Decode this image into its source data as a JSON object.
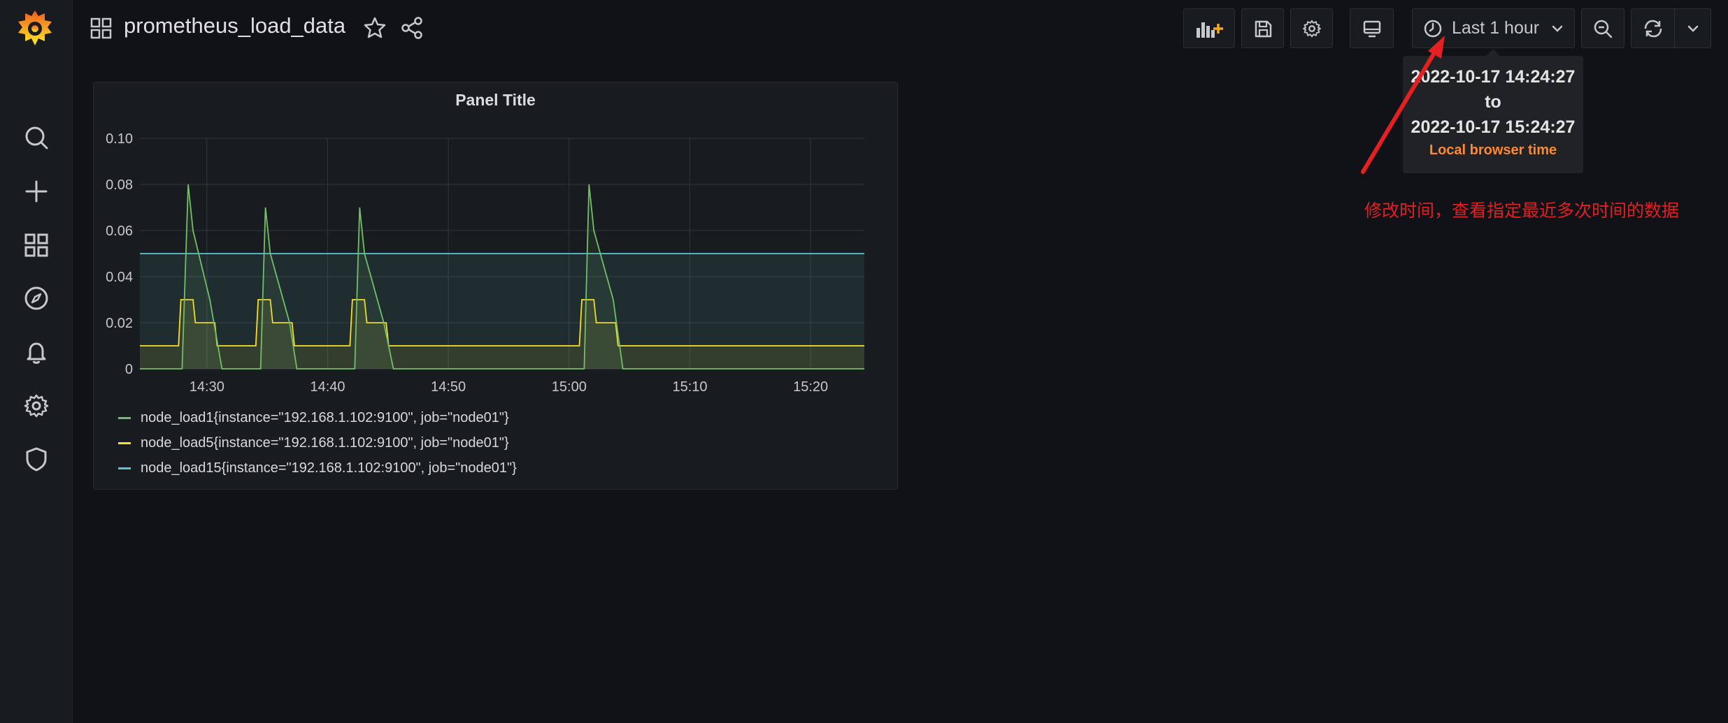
{
  "dashboard": {
    "title": "prometheus_load_data"
  },
  "sidebar": {
    "items": [
      {
        "name": "search-icon"
      },
      {
        "name": "plus-icon"
      },
      {
        "name": "dashboards-icon"
      },
      {
        "name": "explore-icon"
      },
      {
        "name": "alerting-icon"
      },
      {
        "name": "gear-icon"
      },
      {
        "name": "shield-icon"
      }
    ]
  },
  "toolbar": {
    "time_range_label": "Last 1 hour"
  },
  "tooltip": {
    "from": "2022-10-17 14:24:27",
    "to_word": "to",
    "to": "2022-10-17 15:24:27",
    "timezone": "Local browser time"
  },
  "annotation": {
    "text": "修改时间，查看指定最近多次时间的数据"
  },
  "panel": {
    "title": "Panel Title"
  },
  "chart_data": {
    "type": "line",
    "title": "Panel Title",
    "x": [
      "14:24:27",
      "15:24:27"
    ],
    "x_ticks": [
      "14:30",
      "14:40",
      "14:50",
      "15:00",
      "15:10",
      "15:20"
    ],
    "y_ticks": [
      "0",
      "0.02",
      "0.04",
      "0.06",
      "0.08",
      "0.10"
    ],
    "ylim": [
      0,
      0.1
    ],
    "grid": true,
    "legend_position": "bottom-left",
    "series": [
      {
        "name": "node_load1{instance=\"192.168.1.102:9100\", job=\"node01\"}",
        "color": "#73bf69",
        "points": [
          [
            0,
            0
          ],
          [
            3.5,
            0
          ],
          [
            4.0,
            0.08
          ],
          [
            4.4,
            0.06
          ],
          [
            5.8,
            0.03
          ],
          [
            6.8,
            0
          ],
          [
            10,
            0
          ],
          [
            10.4,
            0.07
          ],
          [
            10.8,
            0.05
          ],
          [
            12.4,
            0.02
          ],
          [
            13,
            0
          ],
          [
            17.8,
            0
          ],
          [
            18.2,
            0.07
          ],
          [
            18.6,
            0.05
          ],
          [
            20.2,
            0.02
          ],
          [
            21,
            0
          ],
          [
            36.8,
            0
          ],
          [
            37.2,
            0.08
          ],
          [
            37.6,
            0.06
          ],
          [
            39.2,
            0.03
          ],
          [
            40,
            0
          ],
          [
            60,
            0
          ]
        ]
      },
      {
        "name": "node_load5{instance=\"192.168.1.102:9100\", job=\"node01\"}",
        "color": "#fade2a",
        "points": [
          [
            0,
            0.01
          ],
          [
            3.2,
            0.01
          ],
          [
            3.4,
            0.03
          ],
          [
            4.4,
            0.03
          ],
          [
            4.6,
            0.02
          ],
          [
            6.2,
            0.02
          ],
          [
            6.4,
            0.01
          ],
          [
            9.6,
            0.01
          ],
          [
            9.8,
            0.03
          ],
          [
            10.8,
            0.03
          ],
          [
            11,
            0.02
          ],
          [
            12.6,
            0.02
          ],
          [
            12.8,
            0.01
          ],
          [
            17.4,
            0.01
          ],
          [
            17.6,
            0.03
          ],
          [
            18.6,
            0.03
          ],
          [
            18.8,
            0.02
          ],
          [
            20.4,
            0.02
          ],
          [
            20.6,
            0.01
          ],
          [
            36.4,
            0.01
          ],
          [
            36.6,
            0.03
          ],
          [
            37.6,
            0.03
          ],
          [
            37.8,
            0.02
          ],
          [
            39.4,
            0.02
          ],
          [
            39.6,
            0.01
          ],
          [
            60,
            0.01
          ]
        ]
      },
      {
        "name": "node_load15{instance=\"192.168.1.102:9100\", job=\"node01\"}",
        "color": "#5ec4cf",
        "points": [
          [
            0,
            0.05
          ],
          [
            60,
            0.05
          ]
        ]
      }
    ]
  }
}
